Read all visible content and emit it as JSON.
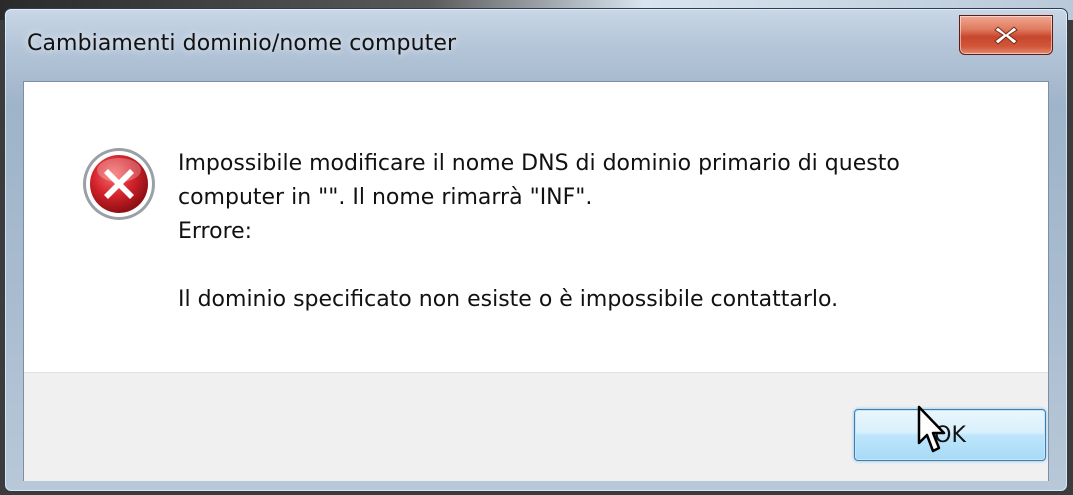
{
  "window": {
    "title": "Cambiamenti dominio/nome computer",
    "close_icon": "close-icon"
  },
  "dialog": {
    "icon": "error-icon",
    "message_line1": "Impossibile modificare il nome DNS di dominio primario di questo",
    "message_line2": "computer in \"\". Il nome rimarrà \"INF\".",
    "message_line3": "Errore:",
    "message_line4": "Il dominio specificato non esiste o è impossibile contattarlo.",
    "ok_label": "OK"
  },
  "colors": {
    "close_button": "#c7462c",
    "error_icon": "#c8202a",
    "ok_button": "#bee6fd"
  }
}
